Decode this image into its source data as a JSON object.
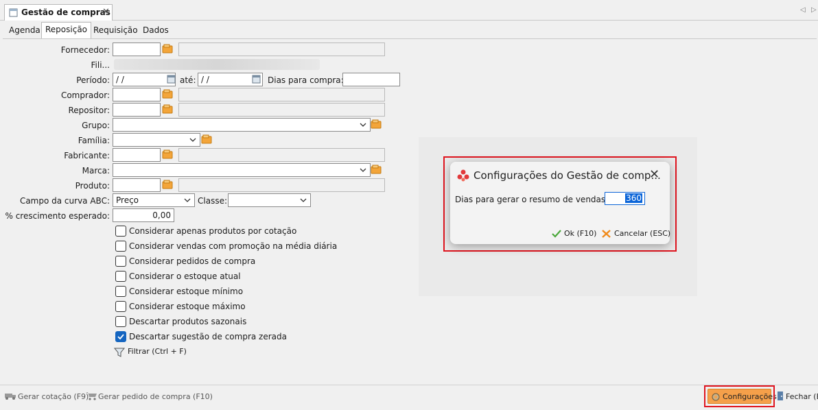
{
  "window": {
    "doc_tab_title": "Gestão de compras",
    "sub_tabs": [
      "Agenda",
      "Reposição",
      "Requisição",
      "Dados"
    ],
    "active_sub_tab": "Reposição"
  },
  "form": {
    "fornecedor_label": "Fornecedor:",
    "filial_label": "Fili...",
    "periodo_label": "Período:",
    "periodo_start": " /  /",
    "ate_label": "até:",
    "periodo_end": " /  /",
    "dias_compra_label": "Dias para compra:",
    "comprador_label": "Comprador:",
    "repositor_label": "Repositor:",
    "grupo_label": "Grupo:",
    "familia_label": "Família:",
    "fabricante_label": "Fabricante:",
    "marca_label": "Marca:",
    "produto_label": "Produto:",
    "curva_label": "Campo da curva ABC:",
    "curva_value": "Preço",
    "classe_label": "Classe:",
    "crescimento_label": "% crescimento esperado:",
    "crescimento_value": "0,00"
  },
  "checkboxes": [
    {
      "label": "Considerar apenas produtos por cotação",
      "checked": false
    },
    {
      "label": "Considerar vendas com promoção na média diária",
      "checked": false
    },
    {
      "label": "Considerar pedidos de compra",
      "checked": false
    },
    {
      "label": "Considerar o estoque atual",
      "checked": false
    },
    {
      "label": "Considerar estoque mínimo",
      "checked": false
    },
    {
      "label": "Considerar estoque máximo",
      "checked": false
    },
    {
      "label": "Descartar produtos sazonais",
      "checked": false
    },
    {
      "label": "Descartar sugestão de compra zerada",
      "checked": true
    }
  ],
  "filter_label": "Filtrar (Ctrl + F)",
  "bottom_bar": {
    "gerar_cotacao": "Gerar cotação (F9)",
    "gerar_pedido": "Gerar pedido de compra (F10)",
    "configuracoes": "Configurações",
    "fechar": "Fechar (E"
  },
  "dialog": {
    "title": "Configurações do Gestão de comp...",
    "field_label": "Dias para gerar o resumo de vendas:",
    "field_value": "360",
    "ok_label": "Ok (F10)",
    "cancel_label": "Cancelar (ESC)"
  },
  "colors": {
    "highlight_red": "#e0141e",
    "config_button_bg": "#f5a04a",
    "checkbox_checked": "#1565c0",
    "selection_blue": "#0a64d8"
  }
}
